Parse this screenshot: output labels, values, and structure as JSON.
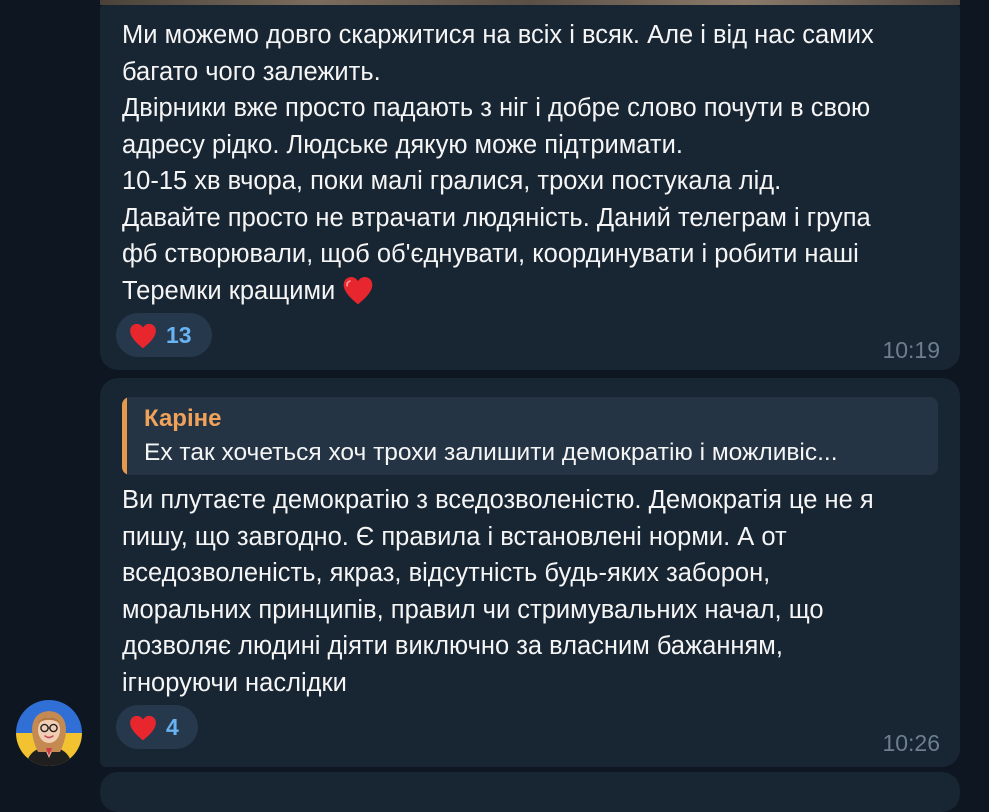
{
  "messages": [
    {
      "text": "Ми можемо довго скаржитися на всіх і всяк. Але і від нас самих\nбагато чого залежить.\nДвірники вже просто падають з ніг і добре слово почути в свою\nадресу рідко. Людське дякую може підтримати.\n10-15 хв вчора, поки малі гралися, трохи постукала лід.\nДавайте просто не втрачати людяність. Даний телеграм і група\nфб створювали, щоб об'єднувати, координувати і робити наші\nТеремки кращими",
      "reaction_count": "13",
      "time": "10:19"
    },
    {
      "reply_author": "Каріне",
      "reply_snippet": "Ех так хочеться хоч трохи залишити демократію і можливіс...",
      "text": "Ви плутаєте демократію з вседозволеністю. Демократія це не я\nпишу, що завгодно. Є правила і встановлені норми. А от\nвседозволеність, якраз, відсутність будь-яких заборон,\nморальних принципів, правил чи стримувальних начал, що\nдозволяє людині діяти виключно за власним бажанням,\nігноруючи наслідки",
      "reaction_count": "4",
      "time": "10:26"
    }
  ],
  "icons": {
    "reaction": "red-heart-icon",
    "inline_emoji": "red-heart-icon",
    "avatar": "user-avatar"
  },
  "colors": {
    "background": "#0e1621",
    "bubble": "#182533",
    "reaction_pill": "#26384b",
    "reaction_count": "#6ab3f3",
    "reply_accent": "#e69a4c",
    "heart": "#e8262e",
    "timestamp": "#6d7f8f"
  }
}
